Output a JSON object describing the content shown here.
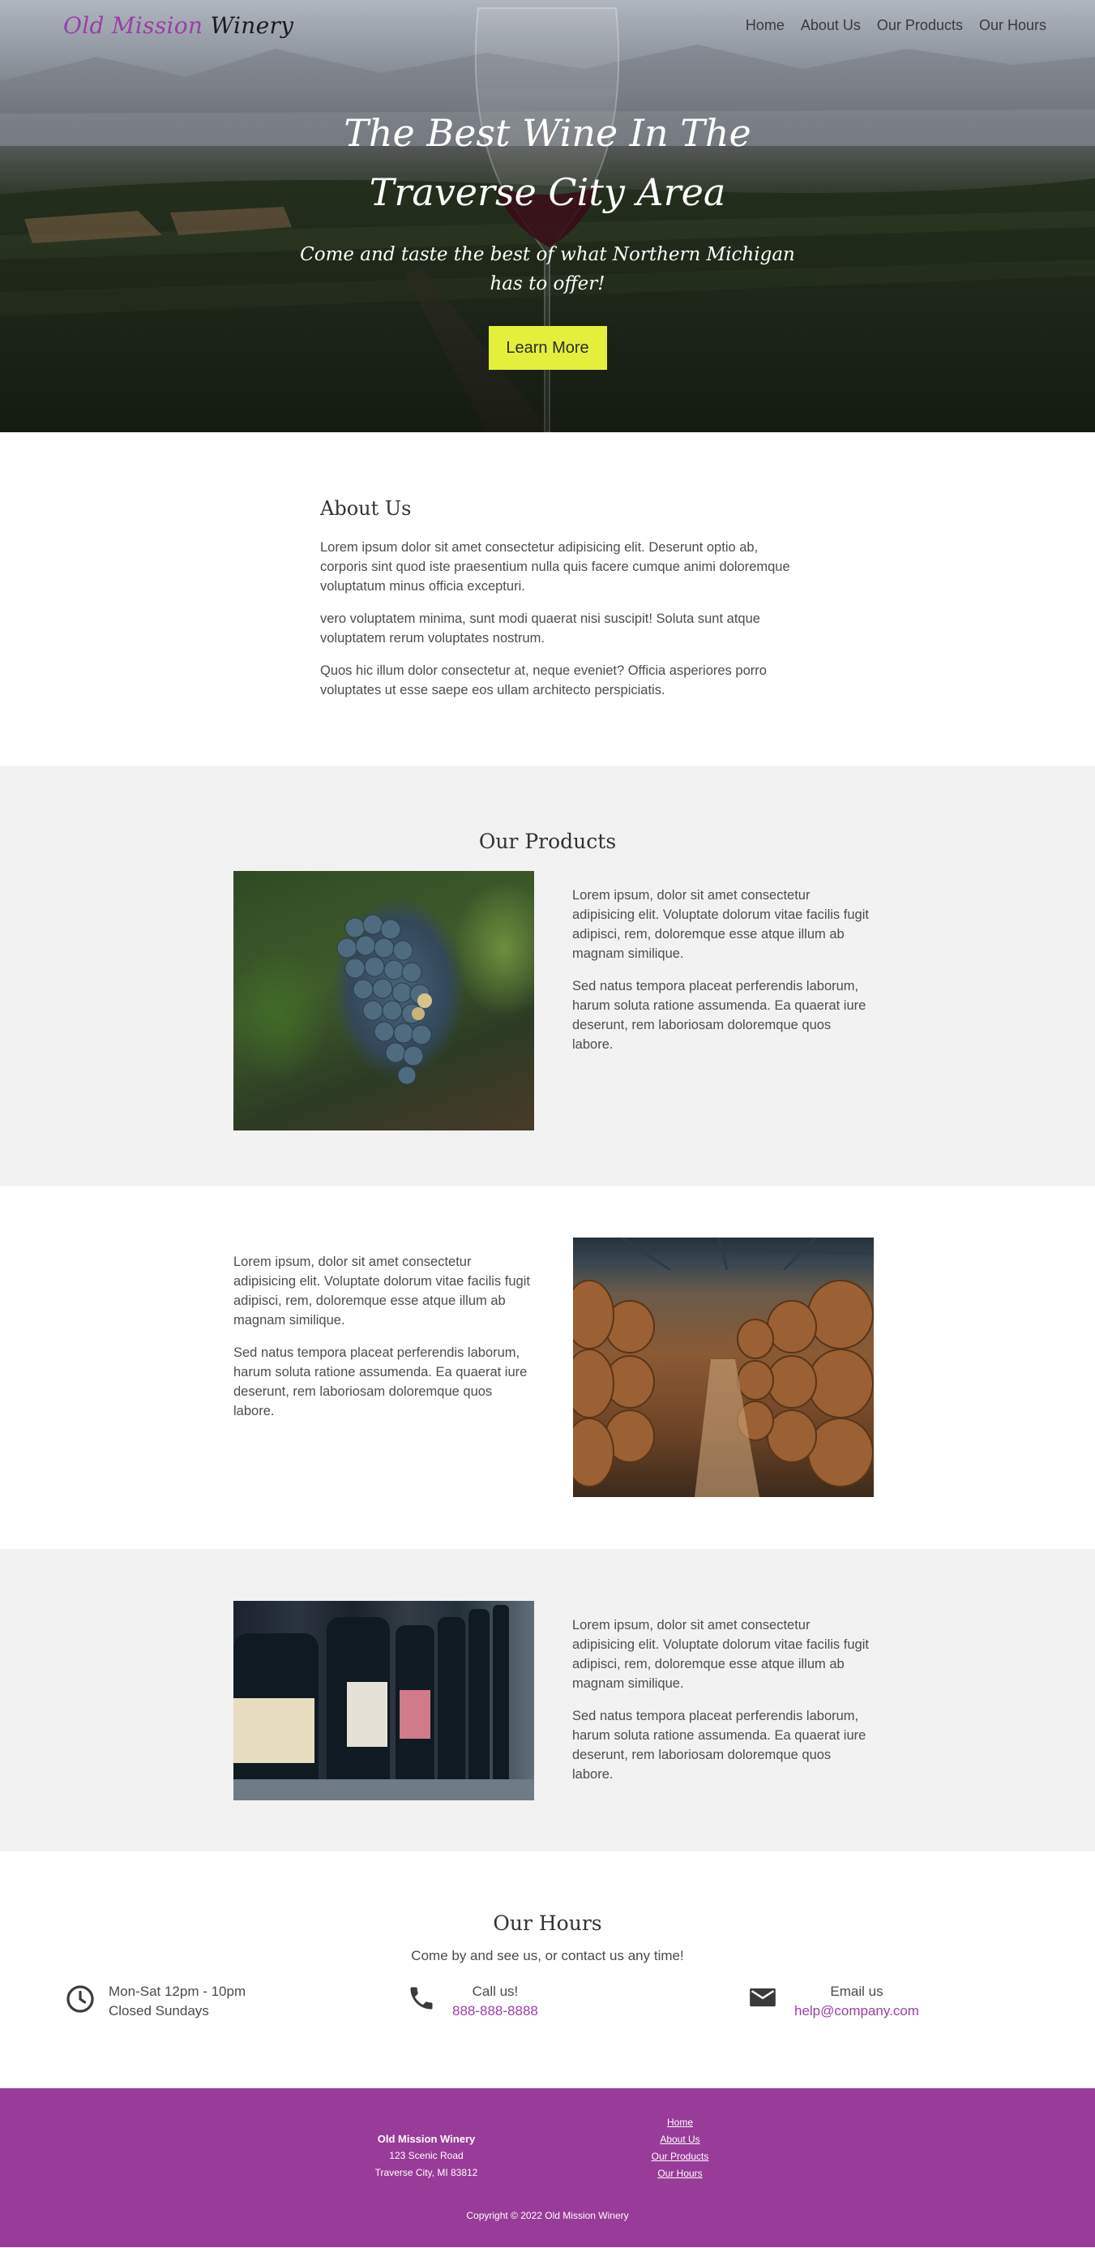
{
  "header": {
    "brand_part1": "Old Mission",
    "brand_part2": "Winery",
    "nav": [
      "Home",
      "About Us",
      "Our Products",
      "Our Hours"
    ]
  },
  "hero": {
    "title": "The Best Wine In The Traverse City Area",
    "subtitle": "Come and taste the best of what Northern Michigan has to offer!",
    "button": "Learn More"
  },
  "about": {
    "heading": "About Us",
    "paragraphs": [
      "Lorem ipsum dolor sit amet consectetur adipisicing elit. Deserunt optio ab, corporis sint quod iste praesentium nulla quis facere cumque animi doloremque voluptatum minus officia excepturi.",
      "vero voluptatem minima, sunt modi quaerat nisi suscipit! Soluta sunt atque voluptatem rerum voluptates nostrum.",
      "Quos hic illum dolor consectetur at, neque eveniet? Officia asperiores porro voluptates ut esse saepe eos ullam architecto perspiciatis."
    ]
  },
  "products": {
    "heading": "Our Products",
    "items": [
      {
        "image_icon": "grapes-photo",
        "p1": "Lorem ipsum, dolor sit amet consectetur adipisicing elit. Voluptate dolorum vitae facilis fugit adipisci, rem, doloremque esse atque illum ab magnam similique.",
        "p2": "Sed natus tempora placeat perferendis laborum, harum soluta ratione assumenda. Ea quaerat iure deserunt, rem laboriosam doloremque quos labore."
      },
      {
        "image_icon": "barrels-photo",
        "p1": "Lorem ipsum, dolor sit amet consectetur adipisicing elit. Voluptate dolorum vitae facilis fugit adipisci, rem, doloremque esse atque illum ab magnam similique.",
        "p2": "Sed natus tempora placeat perferendis laborum, harum soluta ratione assumenda. Ea quaerat iure deserunt, rem laboriosam doloremque quos labore."
      },
      {
        "image_icon": "bottles-photo",
        "p1": "Lorem ipsum, dolor sit amet consectetur adipisicing elit. Voluptate dolorum vitae facilis fugit adipisci, rem, doloremque esse atque illum ab magnam similique.",
        "p2": "Sed natus tempora placeat perferendis laborum, harum soluta ratione assumenda. Ea quaerat iure deserunt, rem laboriosam doloremque quos labore."
      }
    ]
  },
  "hours": {
    "heading": "Our Hours",
    "subtitle": "Come by and see us, or contact us any time!",
    "schedule_line1": "Mon-Sat 12pm - 10pm",
    "schedule_line2": "Closed Sundays",
    "call_label": "Call us!",
    "phone": "888-888-8888",
    "email_label": "Email us",
    "email": "help@company.com"
  },
  "footer": {
    "name": "Old Mission Winery",
    "street": "123 Scenic Road",
    "city": "Traverse City, MI 83812",
    "links": [
      "Home",
      "About Us",
      "Our Products",
      "Our Hours"
    ],
    "copyright": "Copyright © 2022 Old Mission Winery"
  },
  "colors": {
    "brand_purple": "#9b3ea8",
    "footer_purple": "#993b98",
    "button_yellow": "#e4ef3c",
    "section_gray": "#f2f2f2"
  }
}
